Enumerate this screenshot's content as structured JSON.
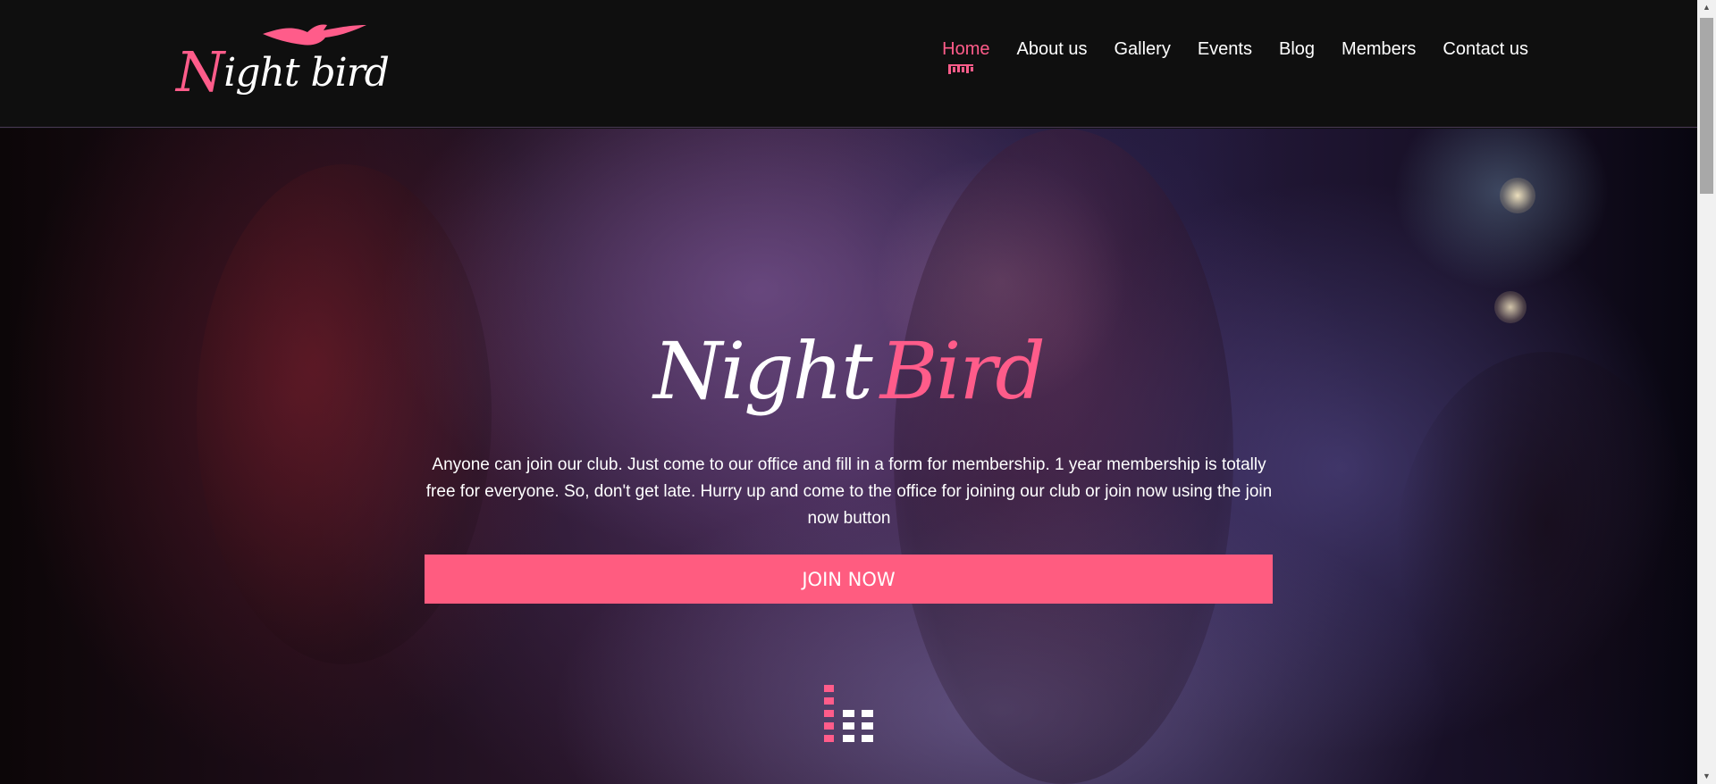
{
  "header": {
    "logo": {
      "text_prefix": "N",
      "text_rest": "ight bird",
      "icon": "bird-icon"
    },
    "nav": [
      {
        "label": "Home",
        "active": true
      },
      {
        "label": "About us",
        "active": false
      },
      {
        "label": "Gallery",
        "active": false
      },
      {
        "label": "Events",
        "active": false
      },
      {
        "label": "Blog",
        "active": false
      },
      {
        "label": "Members",
        "active": false
      },
      {
        "label": "Contact us",
        "active": false
      }
    ],
    "active_indicator_icon": "equalizer-icon"
  },
  "hero": {
    "title_word1": "Night",
    "title_word2": "Bird",
    "description": "Anyone can join our club. Just come to our office and fill in a form for membership. 1 year membership is totally free for everyone. So, don't get late. Hurry up and come to the office for joining our club or join now using the join now button",
    "join_button_label": "JOIN NOW",
    "bottom_icon": "equalizer-icon"
  },
  "colors": {
    "accent": "#ff5c80",
    "header_bg": "#0f0f0f",
    "text": "#ffffff"
  },
  "scrollbar": {
    "up_icon": "scroll-up-arrow-icon",
    "down_icon": "scroll-down-arrow-icon"
  }
}
